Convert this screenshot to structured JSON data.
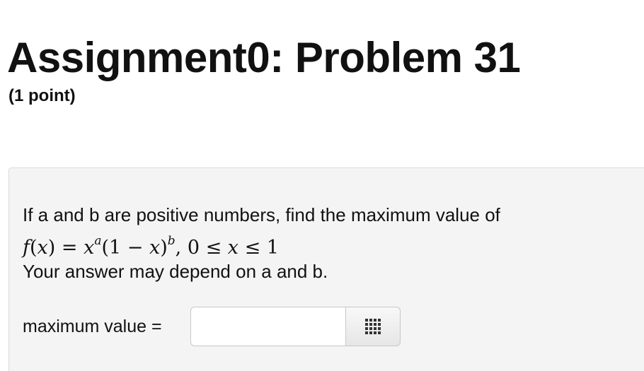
{
  "header": {
    "title": "Assignment0: Problem 31",
    "points": "(1 point)"
  },
  "problem": {
    "intro": "If a and b are positive numbers, find the maximum value of",
    "formula": {
      "f": "f",
      "x": "x",
      "a": "a",
      "b": "b",
      "lhs_open": "(",
      "lhs_close": ") = ",
      "mid_open": "(1 − ",
      "mid_close": ")",
      "comma": ", ",
      "zero_le": "0 ≤ ",
      "le_one": " ≤ 1"
    },
    "note": "Your answer may depend on a and b."
  },
  "answer": {
    "label": "maximum value =",
    "value": "",
    "placeholder": ""
  },
  "icons": {
    "equation_editor": "grid-icon"
  }
}
